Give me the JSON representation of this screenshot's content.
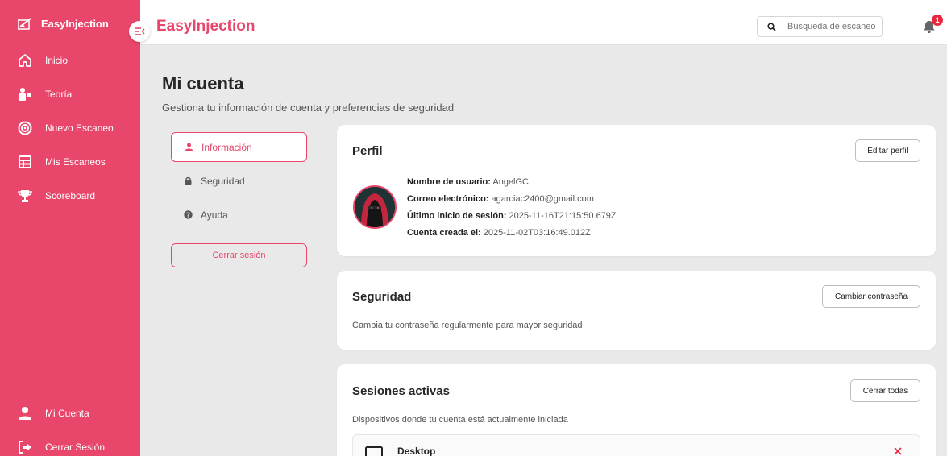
{
  "sidebar": {
    "brand": "EasyInjection",
    "items": [
      {
        "label": "Inicio"
      },
      {
        "label": "Teoría"
      },
      {
        "label": "Nuevo Escaneo"
      },
      {
        "label": "Mis Escaneos"
      },
      {
        "label": "Scoreboard"
      }
    ],
    "bottom_items": [
      {
        "label": "Mi Cuenta"
      },
      {
        "label": "Cerrar Sesión"
      }
    ]
  },
  "header": {
    "title": "EasyInjection",
    "search_placeholder": "Búsqueda de escaneos",
    "notification_count": "1"
  },
  "page": {
    "title": "Mi cuenta",
    "subtitle": "Gestiona tu información de cuenta y preferencias de seguridad"
  },
  "account_menu": {
    "items": [
      {
        "label": "Información"
      },
      {
        "label": "Seguridad"
      },
      {
        "label": "Ayuda"
      }
    ],
    "logout_label": "Cerrar sesión"
  },
  "profile": {
    "title": "Perfil",
    "edit_label": "Editar perfil",
    "fields": [
      {
        "label": "Nombre de usuario:",
        "value": "AngelGC"
      },
      {
        "label": "Correo electrónico:",
        "value": "agarciac2400@gmail.com"
      },
      {
        "label": "Último inicio de sesión:",
        "value": "2025-11-16T21:15:50.679Z"
      },
      {
        "label": "Cuenta creada el:",
        "value": "2025-11-02T03:16:49.012Z"
      }
    ]
  },
  "security": {
    "title": "Seguridad",
    "change_password_label": "Cambiar contraseña",
    "description": "Cambia tu contraseña regularmente para mayor seguridad"
  },
  "sessions": {
    "title": "Sesiones activas",
    "close_all_label": "Cerrar todas",
    "description": "Dispositivos donde tu cuenta está actualmente iniciada",
    "items": [
      {
        "device": "Desktop"
      }
    ]
  },
  "colors": {
    "accent": "#e8466a",
    "background": "#e9e9e9"
  }
}
